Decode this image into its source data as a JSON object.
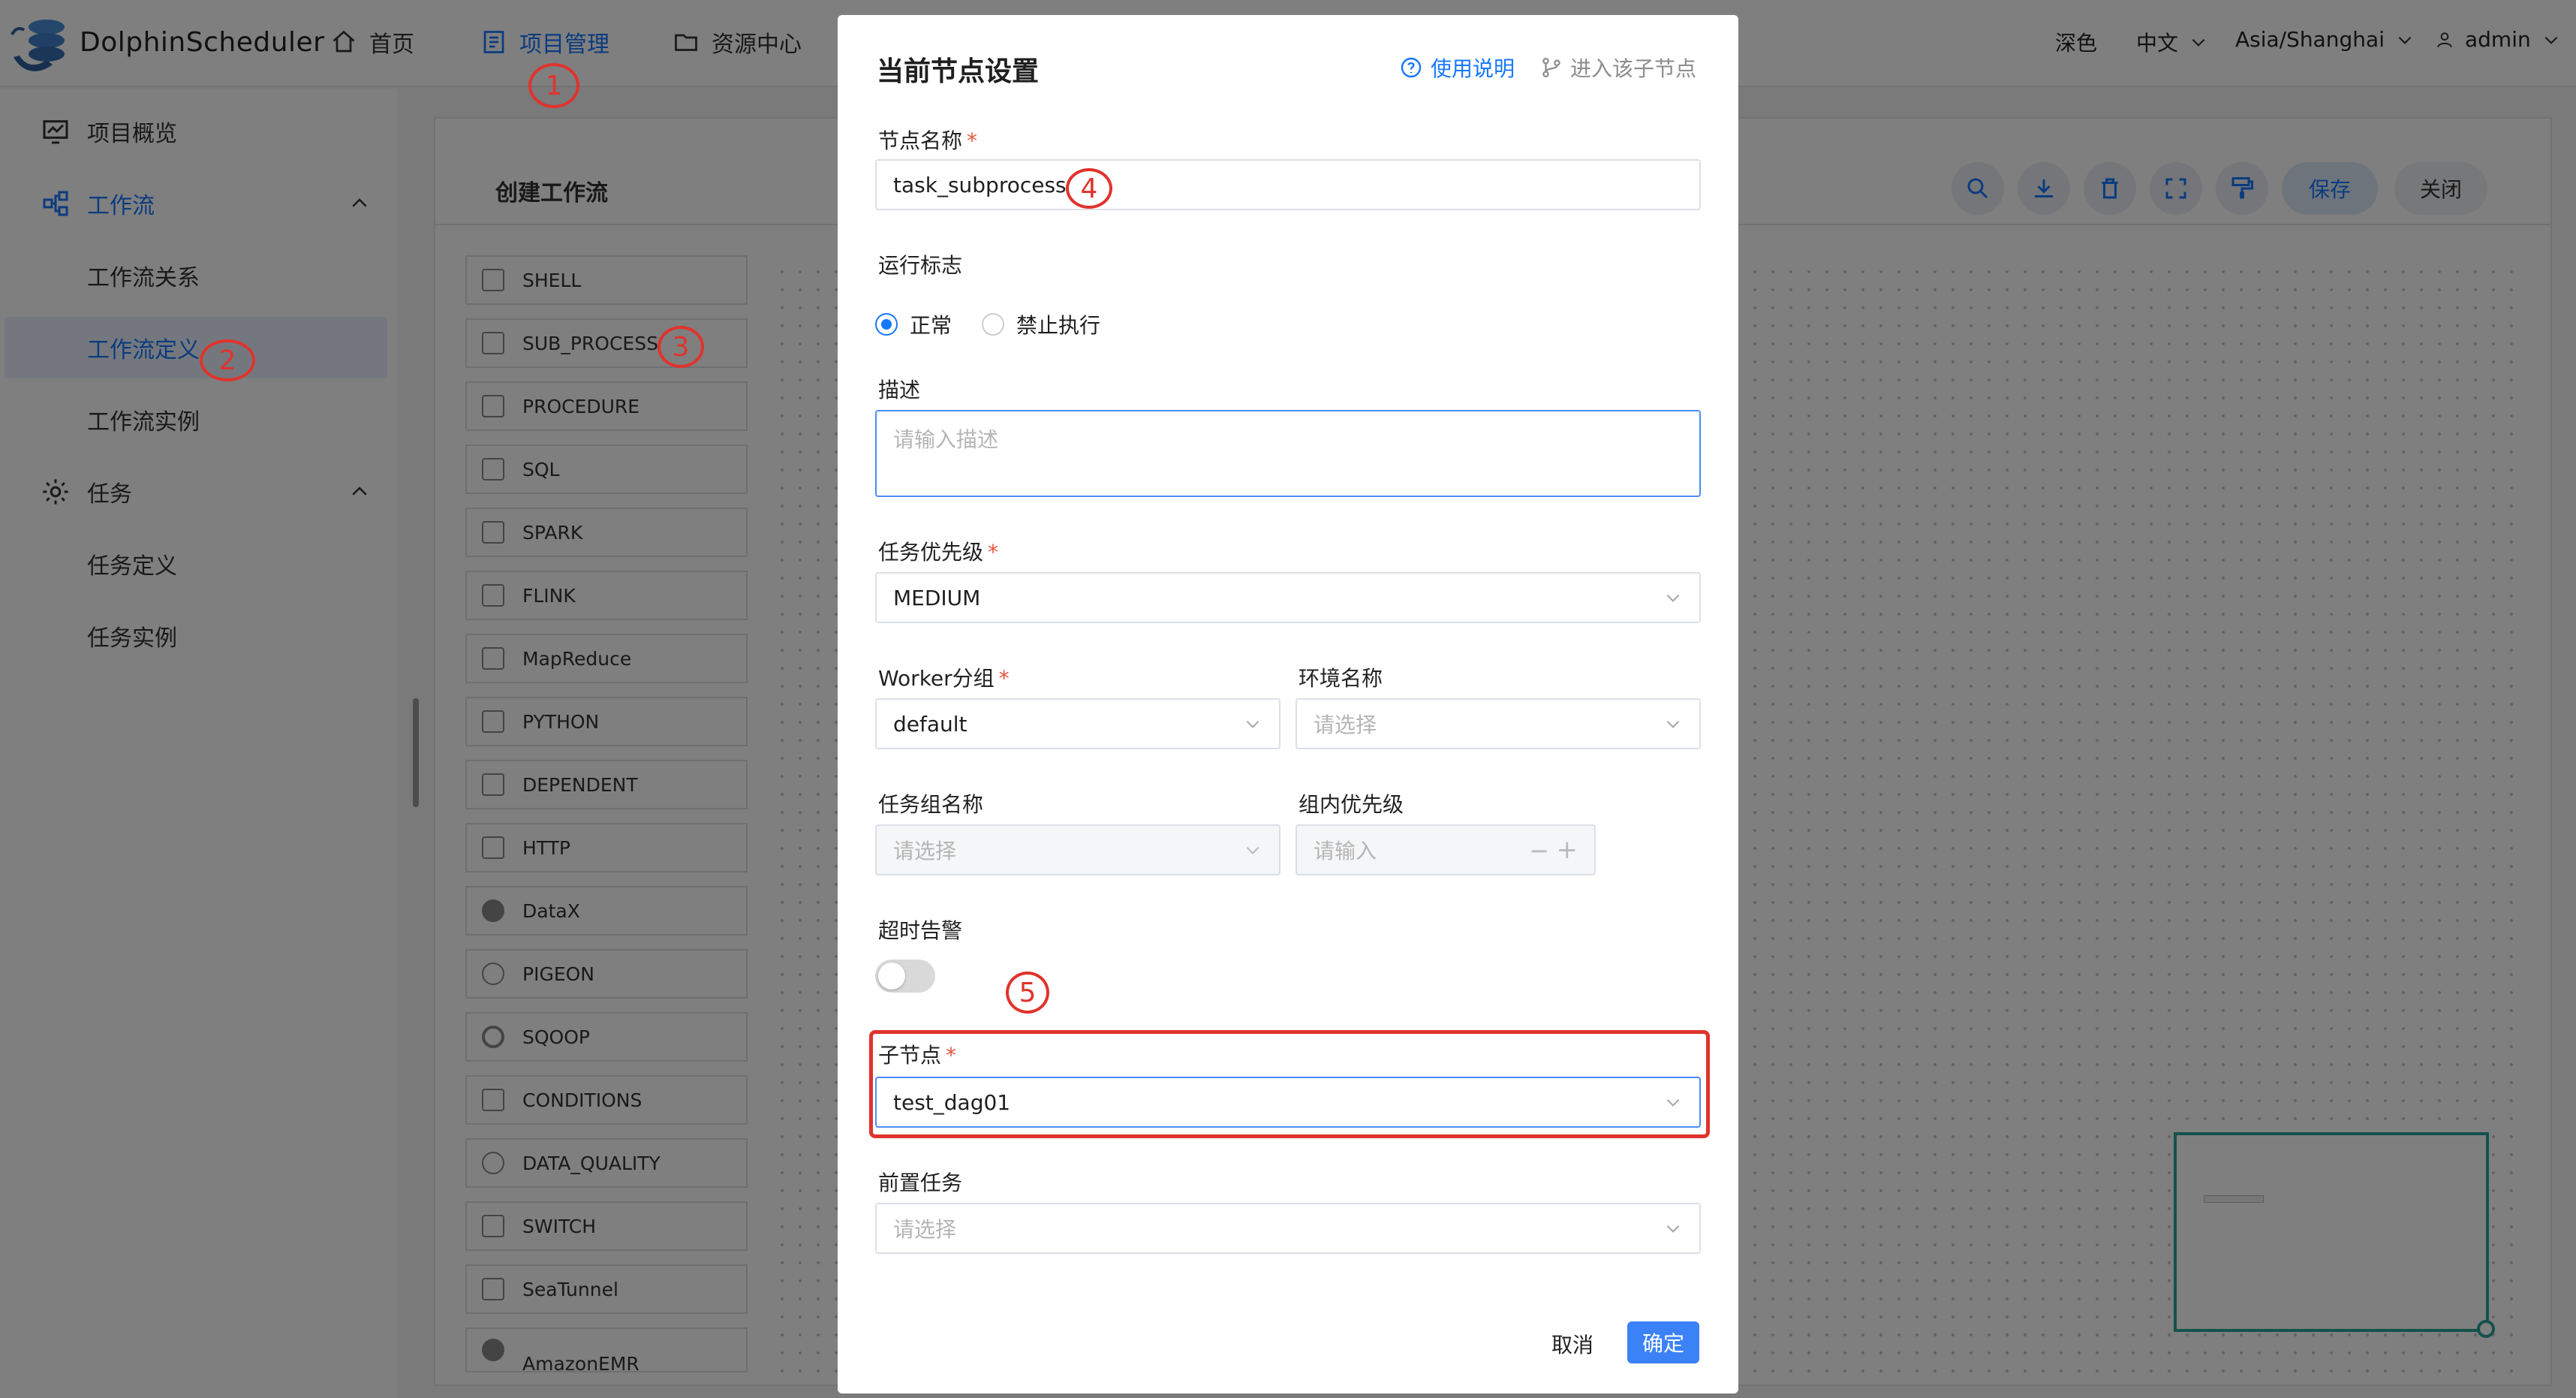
{
  "app": {
    "logo_text": "DolphinScheduler"
  },
  "topnav": {
    "home": "首页",
    "project": "项目管理",
    "resource": "资源中心",
    "theme": "深色",
    "language": "中文",
    "timezone": "Asia/Shanghai",
    "user": "admin"
  },
  "sidebar": {
    "items": [
      {
        "label": "项目概览",
        "icon": "monitor-icon"
      },
      {
        "label": "工作流",
        "icon": "workflow-icon"
      },
      {
        "label": "工作流关系"
      },
      {
        "label": "工作流定义"
      },
      {
        "label": "工作流实例"
      },
      {
        "label": "任务",
        "icon": "gear-icon"
      },
      {
        "label": "任务定义"
      },
      {
        "label": "任务实例"
      }
    ]
  },
  "canvas": {
    "title": "创建工作流",
    "save_label": "保存",
    "close_label": "关闭",
    "tasks": [
      "SHELL",
      "SUB_PROCESS",
      "PROCEDURE",
      "SQL",
      "SPARK",
      "FLINK",
      "MapReduce",
      "PYTHON",
      "DEPENDENT",
      "HTTP",
      "DataX",
      "PIGEON",
      "SQOOP",
      "CONDITIONS",
      "DATA_QUALITY",
      "SWITCH",
      "SeaTunnel",
      "AmazonEMR"
    ]
  },
  "annotations": [
    "1",
    "2",
    "3",
    "4",
    "5"
  ],
  "dialog": {
    "title": "当前节点设置",
    "help_link": "使用说明",
    "enter_child_link": "进入该子节点",
    "node_name_label": "节点名称",
    "node_name_value": "task_subprocess",
    "run_flag_label": "运行标志",
    "run_flag_normal": "正常",
    "run_flag_forbidden": "禁止执行",
    "desc_label": "描述",
    "desc_placeholder": "请输入描述",
    "priority_label": "任务优先级",
    "priority_value": "MEDIUM",
    "worker_group_label": "Worker分组",
    "worker_group_value": "default",
    "env_label": "环境名称",
    "env_placeholder": "请选择",
    "task_group_label": "任务组名称",
    "task_group_placeholder": "请选择",
    "group_priority_label": "组内优先级",
    "group_priority_placeholder": "请输入",
    "timeout_label": "超时告警",
    "timeout_enabled": false,
    "child_node_label": "子节点",
    "child_node_value": "test_dag01",
    "pre_task_label": "前置任务",
    "pre_task_placeholder": "请选择",
    "cancel_label": "取消",
    "ok_label": "确定"
  },
  "colors": {
    "primary": "#1677ff",
    "annotation": "#e0332c",
    "required": "#e8533f",
    "ok_button": "#3b82f6"
  }
}
